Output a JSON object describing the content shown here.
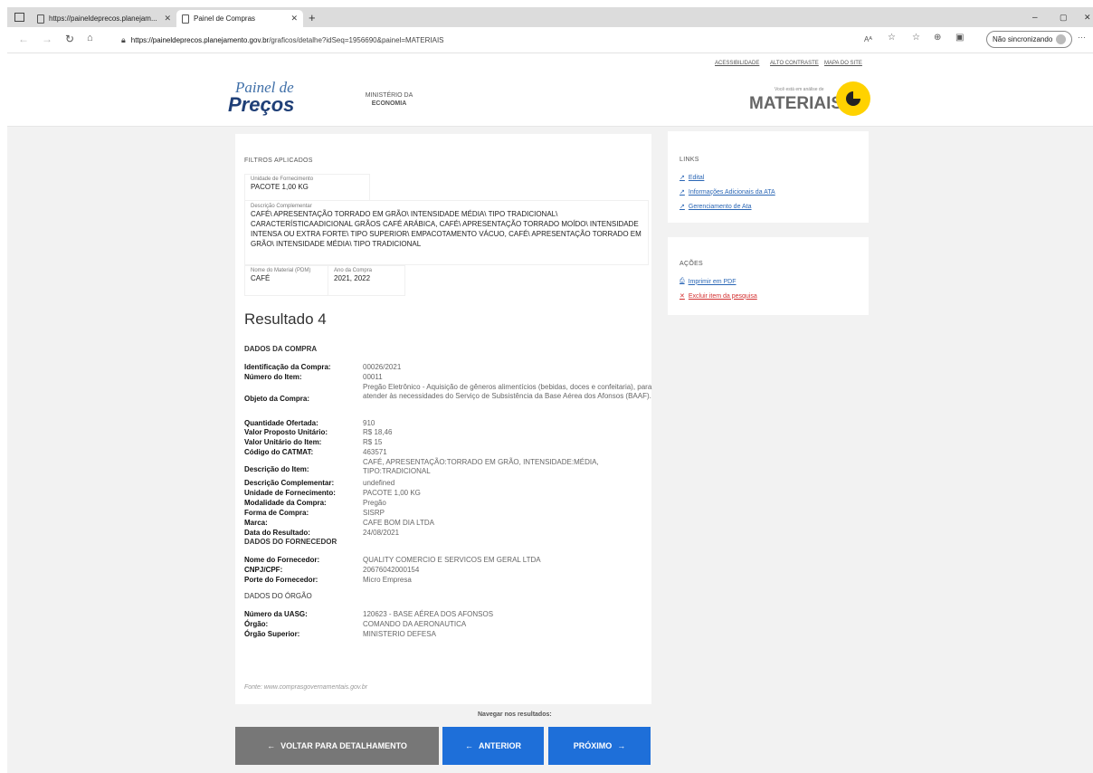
{
  "browser": {
    "tab1_title": "https://paineldeprecos.planejam...",
    "tab2_title": "Painel de Compras",
    "new_tab": "+",
    "url_host": "https://paineldeprecos.planejamento.gov.br",
    "url_path": "/graficos/detalhe?idSeq=1956690&painel=MATERIAIS",
    "sync_label": "Não sincronizando",
    "read_aloud": "Aᴬ",
    "more": "···"
  },
  "header": {
    "logo_line1": "Painel de",
    "logo_line2": "Preços",
    "ministry_line1": "MINISTÉRIO DA",
    "ministry_line2": "ECONOMIA",
    "links": [
      "ACESSIBILIDADE",
      "ALTO CONTRASTE",
      "MAPA DO SITE"
    ],
    "context_small": "Você está em análise de",
    "context": "MATERIAIS"
  },
  "filters": {
    "title": "FILTROS APLICADOS",
    "unit_label": "Unidade de Fornecimento",
    "unit_value": "PACOTE 1,00 KG",
    "desc_label": "Descrição Complementar",
    "desc_value": "CAFÉ\\ APRESENTAÇÃO TORRADO EM GRÃO\\ INTENSIDADE MÉDIA\\ TIPO TRADICIONAL\\ CARACTERÍSTICAADICIONAL GRÃOS CAFÉ ARÁBICA, CAFÉ\\ APRESENTAÇÃO TORRADO MOÍDO\\ INTENSIDADE INTENSA OU EXTRA FORTE\\ TIPO SUPERIOR\\ EMPACOTAMENTO VÁCUO, CAFÉ\\ APRESENTAÇÃO TORRADO EM GRÃO\\ INTENSIDADE MÉDIA\\ TIPO TRADICIONAL",
    "material_label": "Nome do Material (PDM)",
    "material_value": "CAFÉ",
    "year_label": "Ano da Compra",
    "year_value": "2021, 2022"
  },
  "result": {
    "title": "Resultado 4",
    "sec_compra": "DADOS DA COMPRA",
    "compra": [
      {
        "k": "Identificação da Compra:",
        "v": "00026/2021"
      },
      {
        "k": "Número do Item:",
        "v": "00011"
      },
      {
        "k": "Objeto da Compra:",
        "v": "Pregão Eletrônico - Aquisição de gêneros alimentícios (bebidas, doces e confeitaria), para atender às necessidades do Serviço de Subsistência da Base Aérea dos Afonsos (BAAF)."
      },
      {
        "k": "Quantidade Ofertada:",
        "v": "910"
      },
      {
        "k": "Valor Proposto Unitário:",
        "v": "R$ 18,46"
      },
      {
        "k": "Valor Unitário do Item:",
        "v": "R$ 15"
      },
      {
        "k": "Código do CATMAT:",
        "v": "463571"
      },
      {
        "k": "Descrição do Item:",
        "v": "CAFÉ, APRESENTAÇÃO:TORRADO EM GRÃO, INTENSIDADE:MÉDIA, TIPO:TRADICIONAL"
      },
      {
        "k": "Descrição Complementar:",
        "v": "undefined"
      },
      {
        "k": "Unidade de Fornecimento:",
        "v": "PACOTE 1,00 KG"
      },
      {
        "k": "Modalidade da Compra:",
        "v": "Pregão"
      },
      {
        "k": "Forma de Compra:",
        "v": "SISRP"
      },
      {
        "k": "Marca:",
        "v": "CAFE BOM DIA LTDA"
      },
      {
        "k": "Data do Resultado:",
        "v": "24/08/2021"
      }
    ],
    "sec_fornecedor": "DADOS DO FORNECEDOR",
    "fornecedor": [
      {
        "k": "Nome do Fornecedor:",
        "v": "QUALITY COMERCIO E SERVICOS EM GERAL LTDA"
      },
      {
        "k": "CNPJ/CPF:",
        "v": "20676042000154"
      },
      {
        "k": "Porte do Fornecedor:",
        "v": "Micro Empresa"
      }
    ],
    "sec_orgao": "DADOS DO ÓRGÃO",
    "orgao": [
      {
        "k": "Número da UASG:",
        "v": "120623 - BASE AÉREA DOS AFONSOS"
      },
      {
        "k": "Órgão:",
        "v": "COMANDO DA AERONAUTICA"
      },
      {
        "k": "Órgão Superior:",
        "v": "MINISTERIO DEFESA"
      }
    ],
    "fonte": "Fonte: www.comprasgovernamentais.gov.br"
  },
  "links_panel": {
    "title": "LINKS",
    "items": [
      "Edital",
      "Informações Adicionais da ATA",
      "Gerenciamento de Ata"
    ]
  },
  "actions_panel": {
    "title": "AÇÕES",
    "print": "Imprimir em PDF",
    "exclude": "Excluir item da pesquisa"
  },
  "nav": {
    "label": "Navegar nos resultados:",
    "back": "VOLTAR PARA DETALHAMENTO",
    "prev": "ANTERIOR",
    "next": "PRÓXIMO"
  },
  "colors": {
    "primary": "#1e6fd9",
    "secondary": "#777777",
    "accent_yellow": "#ffd200",
    "link": "#2a66b5",
    "danger": "#d32f2f"
  }
}
